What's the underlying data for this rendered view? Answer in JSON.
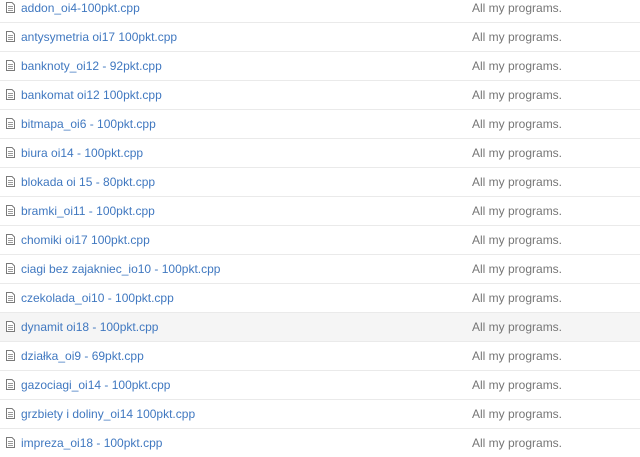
{
  "files": [
    {
      "name": "addon_oi4-100pkt.cpp",
      "message": "All my programs.",
      "icon": "file-text-icon"
    },
    {
      "name": "antysymetria oi17 100pkt.cpp",
      "message": "All my programs.",
      "icon": "file-text-icon"
    },
    {
      "name": "banknoty_oi12 - 92pkt.cpp",
      "message": "All my programs.",
      "icon": "file-text-icon"
    },
    {
      "name": "bankomat oi12 100pkt.cpp",
      "message": "All my programs.",
      "icon": "file-text-icon"
    },
    {
      "name": "bitmapa_oi6 - 100pkt.cpp",
      "message": "All my programs.",
      "icon": "file-text-icon"
    },
    {
      "name": "biura oi14 - 100pkt.cpp",
      "message": "All my programs.",
      "icon": "file-text-icon"
    },
    {
      "name": "blokada oi 15 - 80pkt.cpp",
      "message": "All my programs.",
      "icon": "file-text-icon"
    },
    {
      "name": "bramki_oi11 - 100pkt.cpp",
      "message": "All my programs.",
      "icon": "file-text-icon"
    },
    {
      "name": "chomiki oi17 100pkt.cpp",
      "message": "All my programs.",
      "icon": "file-text-icon"
    },
    {
      "name": "ciagi bez zajakniec_io10 - 100pkt.cpp",
      "message": "All my programs.",
      "icon": "file-text-icon"
    },
    {
      "name": "czekolada_oi10 - 100pkt.cpp",
      "message": "All my programs.",
      "icon": "file-text-icon"
    },
    {
      "name": "dynamit oi18 - 100pkt.cpp",
      "message": "All my programs.",
      "icon": "file-text-icon",
      "highlighted": true
    },
    {
      "name": "działka_oi9 - 69pkt.cpp",
      "message": "All my programs.",
      "icon": "file-text-icon"
    },
    {
      "name": "gazociagi_oi14 - 100pkt.cpp",
      "message": "All my programs.",
      "icon": "file-text-icon"
    },
    {
      "name": "grzbiety i doliny_oi14 100pkt.cpp",
      "message": "All my programs.",
      "icon": "file-text-icon"
    },
    {
      "name": "impreza_oi18 - 100pkt.cpp",
      "message": "All my programs.",
      "icon": "file-text-icon"
    }
  ]
}
